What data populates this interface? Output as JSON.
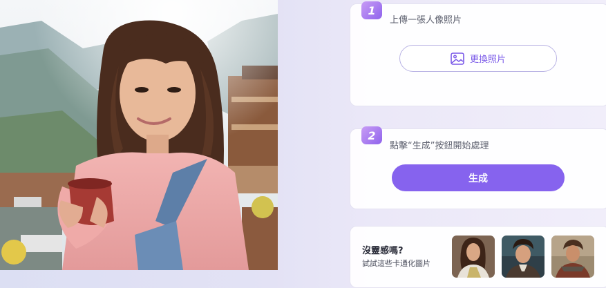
{
  "photo": {
    "alt": "portrait-photo"
  },
  "steps": [
    {
      "number": "1",
      "text": "上傳一張人像照片",
      "button_label": "更換照片",
      "button_icon": "image-icon"
    },
    {
      "number": "2",
      "text": "點擊“生成”按鈕開始處理",
      "button_label": "生成"
    }
  ],
  "inspiration": {
    "title": "沒靈感嗎?",
    "subtitle": "試試這些卡通化圖片",
    "thumbnails": [
      "sample-woman-toga",
      "sample-man-portrait",
      "sample-warrior-portrait"
    ]
  },
  "colors": {
    "accent": "#8663ee",
    "badge_from": "#c89cf5",
    "badge_to": "#8f63ec",
    "outline_button_border": "#b9b3e4"
  }
}
